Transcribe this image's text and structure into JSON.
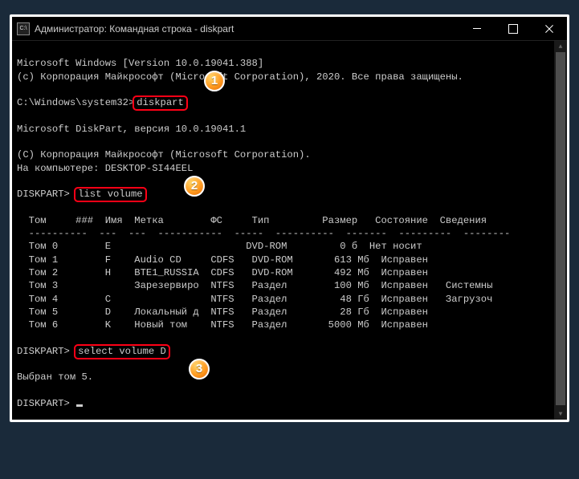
{
  "window": {
    "title": "Администратор: Командная строка - diskpart"
  },
  "lines": {
    "win_version": "Microsoft Windows [Version 10.0.19041.388]",
    "copyright": "(c) Корпорация Майкрософт (Microsoft Corporation), 2020. Все права защищены.",
    "prompt1_path": "C:\\Windows\\system32>",
    "cmd1": "diskpart",
    "dp_version": "Microsoft DiskPart, версия 10.0.19041.1",
    "dp_copyright": "(C) Корпорация Майкрософт (Microsoft Corporation).",
    "dp_computer": "На компьютере: DESKTOP-SI44EEL",
    "prompt2": "DISKPART>",
    "cmd2": "list volume",
    "table_header": "  Том     ###  Имя  Метка        ФС     Тип         Размер   Состояние  Сведения",
    "table_divider": "  ----------  ---  ---  -----------  -----  ----------  -------  ---------  --------",
    "rows": [
      "  Том 0        E                       DVD-ROM         0 б  Нет носит",
      "  Том 1        F    Audio CD     CDFS   DVD-ROM       613 Мб  Исправен",
      "  Том 2        H    BTE1_RUSSIA  CDFS   DVD-ROM       492 Мб  Исправен",
      "  Том 3             Зарезервиро  NTFS   Раздел        100 Мб  Исправен   Системны",
      "  Том 4        C                 NTFS   Раздел         48 Гб  Исправен   Загрузоч",
      "  Том 5        D    Локальный д  NTFS   Раздел         28 Гб  Исправен",
      "  Том 6        K    Новый том    NTFS   Раздел       5000 Мб  Исправен"
    ],
    "cmd3": "select volume D",
    "result3": "Выбран том 5.",
    "prompt_final": "DISKPART> "
  },
  "badges": {
    "b1": "1",
    "b2": "2",
    "b3": "3"
  },
  "chart_data": {
    "type": "table",
    "title": "list volume",
    "columns": [
      "Том",
      "###",
      "Имя",
      "Метка",
      "ФС",
      "Тип",
      "Размер",
      "Состояние",
      "Сведения"
    ],
    "rows": [
      {
        "Том": "Том 0",
        "###": "",
        "Имя": "E",
        "Метка": "",
        "ФС": "",
        "Тип": "DVD-ROM",
        "Размер": "0 б",
        "Состояние": "Нет носит",
        "Сведения": ""
      },
      {
        "Том": "Том 1",
        "###": "",
        "Имя": "F",
        "Метка": "Audio CD",
        "ФС": "CDFS",
        "Тип": "DVD-ROM",
        "Размер": "613 Мб",
        "Состояние": "Исправен",
        "Сведения": ""
      },
      {
        "Том": "Том 2",
        "###": "",
        "Имя": "H",
        "Метка": "BTE1_RUSSIA",
        "ФС": "CDFS",
        "Тип": "DVD-ROM",
        "Размер": "492 Мб",
        "Состояние": "Исправен",
        "Сведения": ""
      },
      {
        "Том": "Том 3",
        "###": "",
        "Имя": "",
        "Метка": "Зарезервиро",
        "ФС": "NTFS",
        "Тип": "Раздел",
        "Размер": "100 Мб",
        "Состояние": "Исправен",
        "Сведения": "Системны"
      },
      {
        "Том": "Том 4",
        "###": "",
        "Имя": "C",
        "Метка": "",
        "ФС": "NTFS",
        "Тип": "Раздел",
        "Размер": "48 Гб",
        "Состояние": "Исправен",
        "Сведения": "Загрузоч"
      },
      {
        "Том": "Том 5",
        "###": "",
        "Имя": "D",
        "Метка": "Локальный д",
        "ФС": "NTFS",
        "Тип": "Раздел",
        "Размер": "28 Гб",
        "Состояние": "Исправен",
        "Сведения": ""
      },
      {
        "Том": "Том 6",
        "###": "",
        "Имя": "K",
        "Метка": "Новый том",
        "ФС": "NTFS",
        "Тип": "Раздел",
        "Размер": "5000 Мб",
        "Состояние": "Исправен",
        "Сведения": ""
      }
    ]
  }
}
